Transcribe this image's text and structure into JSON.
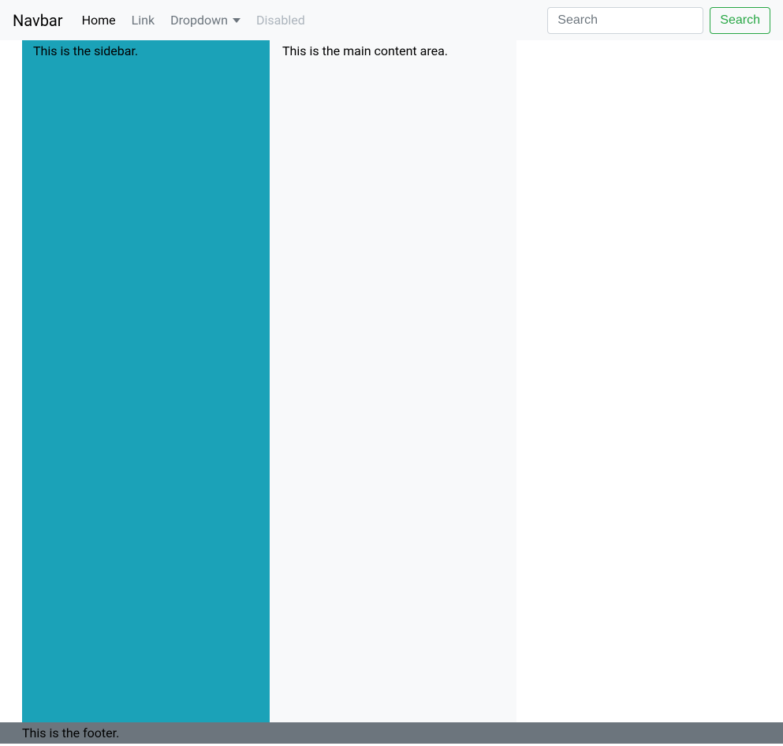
{
  "navbar": {
    "brand": "Navbar",
    "links": {
      "home": "Home",
      "link": "Link",
      "dropdown": "Dropdown",
      "disabled": "Disabled"
    },
    "search": {
      "placeholder": "Search",
      "button": "Search"
    }
  },
  "sidebar": {
    "text": "This is the sidebar."
  },
  "main": {
    "text": "This is the main content area."
  },
  "footer": {
    "text": "This is the footer."
  }
}
